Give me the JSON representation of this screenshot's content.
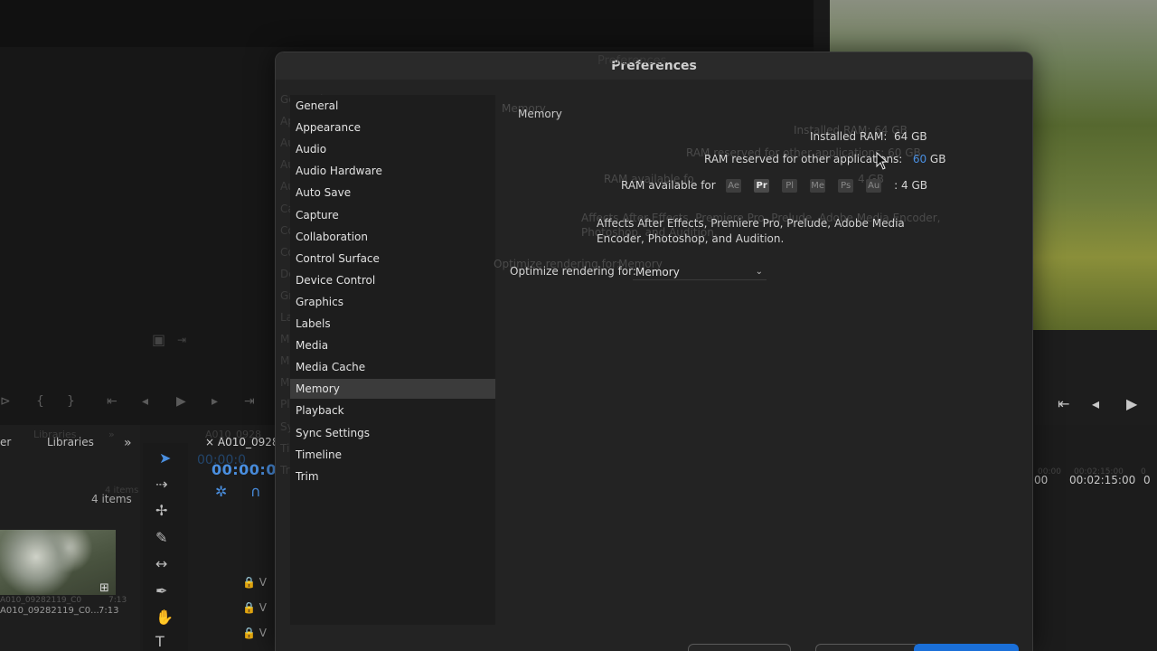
{
  "background": {
    "project_tabs": [
      "er",
      "Libraries"
    ],
    "project_tab_ghost": "Libraries",
    "item_count": "4 items",
    "item_count_ghost": "4 items",
    "clip_name": "A010_09282119_C0...",
    "clip_name_ghost": "A010_09282119_C0",
    "clip_duration": "7:13",
    "clip_duration_ghost": "7:13",
    "sequence_tab": "A010_0928",
    "sequence_tab_ghost": "A010_0928",
    "timecode": "00:00:00",
    "timecode_ghost": "00:00:0",
    "right_timecodes": [
      ":00",
      "00:02:15:00",
      "0"
    ],
    "right_timecodes_ghost": [
      "00:00",
      "00:02:15:00",
      "0"
    ],
    "track_letters": [
      "V",
      "V",
      "V"
    ]
  },
  "dialog": {
    "title": "Preferences",
    "ghost_title": "Preferences",
    "categories": [
      "General",
      "Appearance",
      "Audio",
      "Audio Hardware",
      "Auto Save",
      "Capture",
      "Collaboration",
      "Control Surface",
      "Device Control",
      "Graphics",
      "Labels",
      "Media",
      "Media Cache",
      "Memory",
      "Playback",
      "Sync Settings",
      "Timeline",
      "Trim"
    ],
    "ghost_categories": [
      "General",
      "Appearance",
      "Audio",
      "Audio Hardware",
      "Auto Save",
      "Capture",
      "Collaboration",
      "Control Surface",
      "Device Control",
      "Graphics",
      "Labels",
      "Media",
      "Media Cache",
      "Me",
      "Playback",
      "Sync Settings",
      "Timeline",
      "Trim"
    ],
    "selected_category": "Memory",
    "memory": {
      "heading": "Memory",
      "ghost_heading": "Memory",
      "installed_ram_label": "Installed RAM:",
      "installed_ram_value": "64 GB",
      "ghost_installed_ram": "Installed RAM:  64 GB",
      "reserved_label": "RAM reserved for other applications:",
      "reserved_value": "60",
      "reserved_unit": "GB",
      "ghost_reserved": "RAM reserved for other applications:  60 GB",
      "available_label": "RAM available for",
      "available_apps": [
        "Ae",
        "Pr",
        "Pl",
        "Me",
        "Ps",
        "Au"
      ],
      "active_app": "Pr",
      "available_value": ":  4 GB",
      "ghost_available": "RAM available fo",
      "ghost_available_value": "4 GB",
      "note": "Affects After Effects, Premiere Pro, Prelude, Adobe Media Encoder, Photoshop, and Audition.",
      "ghost_note_1": "Affects After Effects, Premiere Pro, Prelude, Adobe Media Encoder,",
      "ghost_note_2": "Photoshop, and Audition.",
      "optimize_label": "Optimize rendering for:",
      "optimize_value": "Memory",
      "ghost_optimize_label": "Optimize rendering for:",
      "ghost_optimize_value": "Memory"
    }
  },
  "colors": {
    "accent": "#4a90e2",
    "dialog_bg": "#232323",
    "selected_bg": "#3b3b3b"
  }
}
